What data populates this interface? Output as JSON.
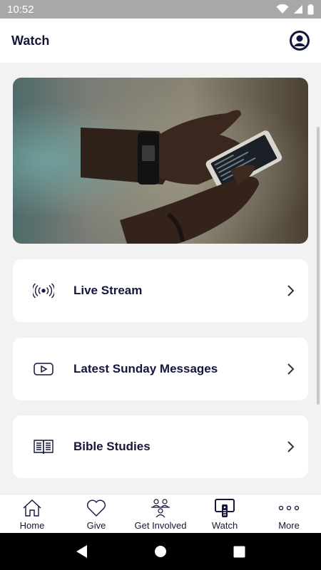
{
  "status_bar": {
    "time": "10:52"
  },
  "header": {
    "title": "Watch"
  },
  "hero": {
    "image": "hands-holding-smartphone-photo"
  },
  "menu": [
    {
      "label": "Live Stream",
      "icon": "live-broadcast-icon"
    },
    {
      "label": "Latest Sunday Messages",
      "icon": "video-play-icon"
    },
    {
      "label": "Bible Studies",
      "icon": "open-book-icon"
    }
  ],
  "tabs": [
    {
      "label": "Home",
      "icon": "home-icon"
    },
    {
      "label": "Give",
      "icon": "heart-icon"
    },
    {
      "label": "Get Involved",
      "icon": "people-icon"
    },
    {
      "label": "Watch",
      "icon": "tv-remote-icon",
      "active": true
    },
    {
      "label": "More",
      "icon": "more-dots-icon"
    }
  ],
  "colors": {
    "accent": "#14163a",
    "background": "#f2f2f2",
    "status_bar": "#a8a8a8"
  }
}
